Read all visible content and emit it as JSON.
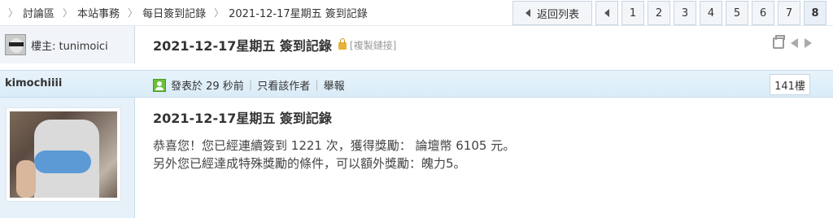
{
  "breadcrumb": [
    {
      "label": "討論區"
    },
    {
      "label": "本站事務"
    },
    {
      "label": "每日簽到記錄"
    },
    {
      "label": "2021-12-17星期五 簽到記錄"
    }
  ],
  "pager": {
    "back_label": "返回列表",
    "pages": [
      "1",
      "2",
      "3",
      "4",
      "5",
      "6",
      "7"
    ],
    "current": "8"
  },
  "thread": {
    "owner_label": "樓主: tunimoici",
    "title": "2021-12-17星期五 簽到記錄",
    "copy_link": "[複製鏈接]"
  },
  "post": {
    "author": "kimochiiii",
    "posted": "發表於 29 秒前",
    "only_author": "只看該作者",
    "report": "舉報",
    "floor": "141樓",
    "title": "2021-12-17星期五 簽到記錄",
    "line1": "恭喜您！您已經連續簽到 1221 次，獲得獎勵： 論壇幣 6105 元。",
    "line2": "另外您已經達成特殊獎勵的條件，可以額外獎勵：魄力5。"
  },
  "icons": {
    "lock": "lock-icon",
    "print": "print-icon",
    "prev_thread": "arrow-left-icon",
    "next_thread": "arrow-right-icon",
    "online": "online-status-icon"
  }
}
